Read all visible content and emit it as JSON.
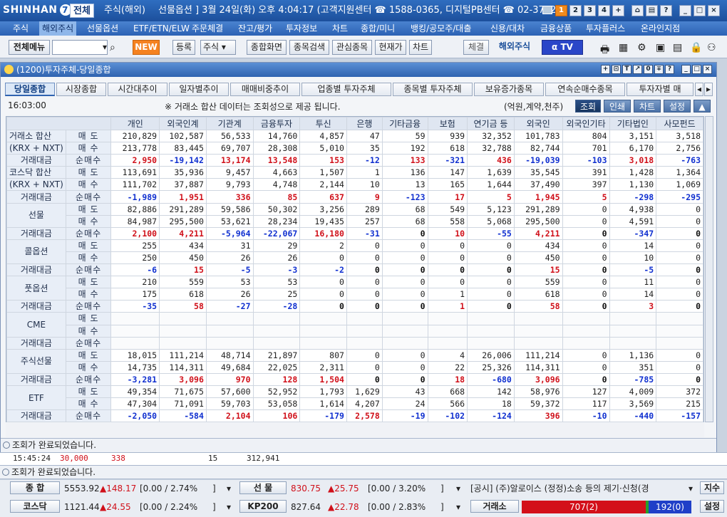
{
  "titlebar": {
    "brand": "SHINHAN",
    "tab_all": "전체",
    "tab_overseas": "주식(해외)",
    "info": "선물옵션 ] 3월 24일(화) 오후 4:04:17 (고객지원센터 ☎ 1588-0365, 디지털PB센터 ☎ 02-3772-",
    "num_buttons": [
      "1",
      "2",
      "3",
      "4",
      "+"
    ],
    "ctrl_buttons": [
      "⌂",
      "▤",
      "?",
      "_",
      "□",
      "×"
    ]
  },
  "menu": [
    "주식",
    "해외주식",
    "선물옵션",
    "ETF/ETN/ELW",
    "주문체결",
    "잔고/평가",
    "투자정보",
    "차트",
    "종합/미니",
    "뱅킹/공모주/대출",
    "신용/대차",
    "금융상품",
    "투자플러스",
    "온라인지점"
  ],
  "menu_selected": "해외주식",
  "toolbar": {
    "menu_button": "전체메뉴",
    "new_badge": "NEW",
    "register": "등록",
    "stock_select": "주식",
    "buttons": [
      "종합화면",
      "종목검색",
      "관심종목",
      "현재가",
      "차트"
    ],
    "settle": "체결",
    "overseas": "해외주식",
    "tv": "TV"
  },
  "window": {
    "title": "(1200)투자주체-당일종합",
    "controls": [
      "+",
      "⊡",
      "T",
      "↗",
      "0",
      "∓",
      "?",
      "_",
      "□",
      "×"
    ]
  },
  "tabs": [
    "당일종합",
    "시장종합",
    "시간대추이",
    "일자별추이",
    "매매비중추이",
    "업종별 투자주체",
    "종목별 투자주체",
    "보유증가종목",
    "연속순매수종목",
    "투자자별 매"
  ],
  "active_tab": "당일종합",
  "info": {
    "time": "16:03:00",
    "notice": "※ 거래소 합산 데이터는 조회성으로 제공 됩니다.",
    "unit": "(억원,계약,천주)",
    "buttons": [
      "조회",
      "인쇄",
      "차트",
      "설정",
      "▲"
    ]
  },
  "columns": [
    "개인",
    "외국인계",
    "기관계",
    "금융투자",
    "투신",
    "은행",
    "기타금융",
    "보험",
    "연기금 등",
    "외국인",
    "외국인기타",
    "기타법인",
    "사모펀드"
  ],
  "row_types": {
    "sell": "매 도",
    "buy": "매 수",
    "net": "순매수",
    "amount": "거래대금"
  },
  "groups": [
    {
      "name1": "거래소 합산",
      "name2": "(KRX + NXT)",
      "sell": [
        "210,829",
        "102,587",
        "56,533",
        "14,760",
        "4,857",
        "47",
        "59",
        "939",
        "32,352",
        "101,783",
        "804",
        "3,151",
        "3,518"
      ],
      "buy": [
        "213,778",
        "83,445",
        "69,707",
        "28,308",
        "5,010",
        "35",
        "192",
        "618",
        "32,788",
        "82,744",
        "701",
        "6,170",
        "2,756"
      ],
      "net": [
        "2,950",
        "-19,142",
        "13,174",
        "13,548",
        "153",
        "-12",
        "133",
        "-321",
        "436",
        "-19,039",
        "-103",
        "3,018",
        "-763"
      ]
    },
    {
      "name1": "코스닥 합산",
      "name2": "(KRX + NXT)",
      "sell": [
        "113,691",
        "35,936",
        "9,457",
        "4,663",
        "1,507",
        "1",
        "136",
        "147",
        "1,639",
        "35,545",
        "391",
        "1,428",
        "1,364"
      ],
      "buy": [
        "111,702",
        "37,887",
        "9,793",
        "4,748",
        "2,144",
        "10",
        "13",
        "165",
        "1,644",
        "37,490",
        "397",
        "1,130",
        "1,069"
      ],
      "net": [
        "-1,989",
        "1,951",
        "336",
        "85",
        "637",
        "9",
        "-123",
        "17",
        "5",
        "1,945",
        "5",
        "-298",
        "-295"
      ]
    },
    {
      "name1": "선물",
      "name2": "",
      "sell": [
        "82,886",
        "291,289",
        "59,586",
        "50,302",
        "3,256",
        "289",
        "68",
        "549",
        "5,123",
        "291,289",
        "0",
        "4,938",
        "0"
      ],
      "buy": [
        "84,987",
        "295,500",
        "53,621",
        "28,234",
        "19,435",
        "257",
        "68",
        "558",
        "5,068",
        "295,500",
        "0",
        "4,591",
        "0"
      ],
      "net": [
        "2,100",
        "4,211",
        "-5,964",
        "-22,067",
        "16,180",
        "-31",
        "0",
        "10",
        "-55",
        "4,211",
        "0",
        "-347",
        "0"
      ]
    },
    {
      "name1": "콜옵션",
      "name2": "",
      "sell": [
        "255",
        "434",
        "31",
        "29",
        "2",
        "0",
        "0",
        "0",
        "0",
        "434",
        "0",
        "14",
        "0"
      ],
      "buy": [
        "250",
        "450",
        "26",
        "26",
        "0",
        "0",
        "0",
        "0",
        "0",
        "450",
        "0",
        "10",
        "0"
      ],
      "net": [
        "-6",
        "15",
        "-5",
        "-3",
        "-2",
        "0",
        "0",
        "0",
        "0",
        "15",
        "0",
        "-5",
        "0"
      ]
    },
    {
      "name1": "풋옵션",
      "name2": "",
      "sell": [
        "210",
        "559",
        "53",
        "53",
        "0",
        "0",
        "0",
        "0",
        "0",
        "559",
        "0",
        "11",
        "0"
      ],
      "buy": [
        "175",
        "618",
        "26",
        "25",
        "0",
        "0",
        "0",
        "1",
        "0",
        "618",
        "0",
        "14",
        "0"
      ],
      "net": [
        "-35",
        "58",
        "-27",
        "-28",
        "0",
        "0",
        "0",
        "1",
        "0",
        "58",
        "0",
        "3",
        "0"
      ]
    },
    {
      "name1": "CME",
      "name2": "",
      "sell": [
        "",
        "",
        "",
        "",
        "",
        "",
        "",
        "",
        "",
        "",
        "",
        "",
        ""
      ],
      "buy": [
        "",
        "",
        "",
        "",
        "",
        "",
        "",
        "",
        "",
        "",
        "",
        "",
        ""
      ],
      "net": [
        "",
        "",
        "",
        "",
        "",
        "",
        "",
        "",
        "",
        "",
        "",
        "",
        ""
      ]
    },
    {
      "name1": "주식선물",
      "name2": "",
      "sell": [
        "18,015",
        "111,214",
        "48,714",
        "21,897",
        "807",
        "0",
        "0",
        "4",
        "26,006",
        "111,214",
        "0",
        "1,136",
        "0"
      ],
      "buy": [
        "14,735",
        "114,311",
        "49,684",
        "22,025",
        "2,311",
        "0",
        "0",
        "22",
        "25,326",
        "114,311",
        "0",
        "351",
        "0"
      ],
      "net": [
        "-3,281",
        "3,096",
        "970",
        "128",
        "1,504",
        "0",
        "0",
        "18",
        "-680",
        "3,096",
        "0",
        "-785",
        "0"
      ]
    },
    {
      "name1": "ETF",
      "name2": "",
      "sell": [
        "49,354",
        "71,675",
        "57,600",
        "52,952",
        "1,793",
        "1,629",
        "43",
        "668",
        "142",
        "58,976",
        "127",
        "4,009",
        "372"
      ],
      "buy": [
        "47,304",
        "71,091",
        "59,703",
        "53,058",
        "1,614",
        "4,207",
        "24",
        "566",
        "18",
        "59,372",
        "117",
        "3,569",
        "215"
      ],
      "net": [
        "-2,050",
        "-584",
        "2,104",
        "106",
        "-179",
        "2,578",
        "-19",
        "-102",
        "-124",
        "396",
        "-10",
        "-440",
        "-157"
      ]
    }
  ],
  "status1": "조회가 완료되었습니다.",
  "behind_row": {
    "time": "15:45:24",
    "a": "30,000",
    "b": "338",
    "c": "15",
    "d": "312,941"
  },
  "status2": "조회가 완료되었습니다.",
  "ticker": {
    "row1": {
      "l1": "종 합",
      "v1": "5553.92",
      "c1": "▲148.17",
      "p1": "[0.00 / 2.74%",
      "l2": "선 물",
      "v2": "830.75",
      "c2": "▲25.75",
      "p2": "[0.00 / 3.20%",
      "news": "[공시] (주)알로이스 (정정)소송 등의 제기·신청(경",
      "btn": "지수"
    },
    "row2": {
      "l1": "코스닥",
      "v1": "1121.44",
      "c1": "▲24.55",
      "p1": "[0.00 / 2.24%",
      "l2": "KP200",
      "v2": "827.64",
      "c2": "▲22.78",
      "p2": "[0.00 / 2.83%",
      "l3": "거래소",
      "up": "707(2)",
      "down": "192(0)",
      "btn": "설정"
    }
  }
}
